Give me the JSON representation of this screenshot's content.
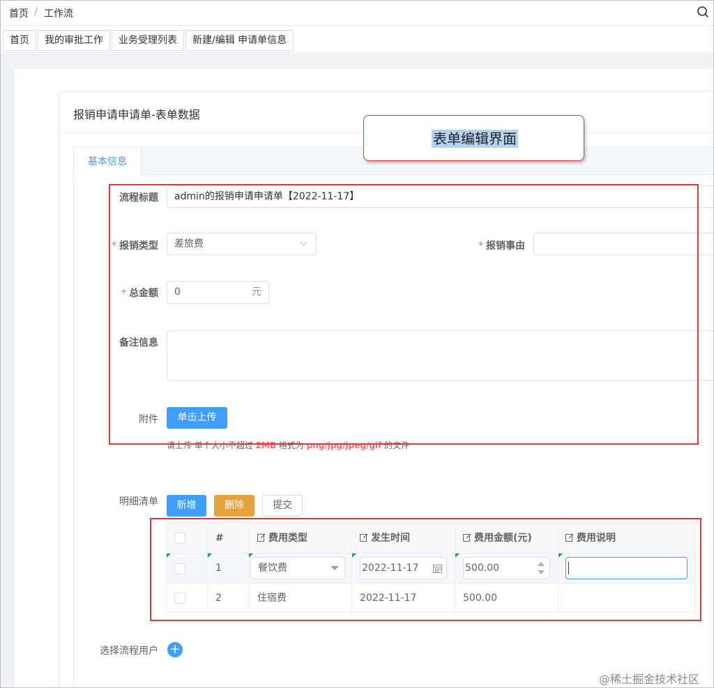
{
  "breadcrumb": {
    "home": "首页",
    "separator": "/",
    "current": "工作流"
  },
  "tags": [
    {
      "label": "首页"
    },
    {
      "label": "我的审批工作"
    },
    {
      "label": "业务受理列表"
    },
    {
      "label": "新建/编辑 申请单信息"
    }
  ],
  "card": {
    "title": "报销申请申请单-表单数据"
  },
  "annotation": {
    "text": "表单编辑界面"
  },
  "tabs": [
    {
      "label": "基本信息",
      "active": true
    }
  ],
  "form": {
    "process_title": {
      "label": "流程标题",
      "value": "admin的报销申请申请单【2022-11-17】"
    },
    "expense_type": {
      "required": "*",
      "label": "报销类型",
      "value": "差旅费"
    },
    "expense_reason": {
      "required": "*",
      "label": "报销事由",
      "value": ""
    },
    "total_amount": {
      "required": "*",
      "label": "总金额",
      "value": "0",
      "suffix": "元"
    },
    "remarks": {
      "label": "备注信息",
      "value": ""
    },
    "attachment": {
      "label": "附件",
      "upload_button": "单击上传"
    },
    "upload_hint": {
      "prefix": "请上传 单个大小不超过 ",
      "size": "2MB",
      "mid": " 格式为 ",
      "formats": "png/jpg/jpeg/gif",
      "suffix": " 的文件"
    }
  },
  "detail": {
    "label": "明细清单",
    "buttons": {
      "add": "新增",
      "delete": "删除",
      "submit": "提交"
    },
    "columns": [
      "#",
      "费用类型",
      "发生时间",
      "费用金额(元)",
      "费用说明"
    ],
    "rows": [
      {
        "index": "1",
        "type": "餐饮费",
        "date": "2022-11-17",
        "amount": "500.00",
        "desc": ""
      },
      {
        "index": "2",
        "type": "住宿费",
        "date": "2022-11-17",
        "amount": "500.00",
        "desc": ""
      }
    ]
  },
  "select_users": {
    "label": "选择流程用户"
  },
  "watermark": "@稀土掘金技术社区",
  "colors": {
    "primary": "#409eff",
    "warning": "#e6a23c",
    "danger": "#f56c6c",
    "highlight_border": "#e0373b"
  },
  "icons": [
    "search-icon",
    "chevron-down-icon",
    "calendar-icon",
    "spinner-arrows-icon",
    "edit-icon",
    "plus-icon"
  ]
}
